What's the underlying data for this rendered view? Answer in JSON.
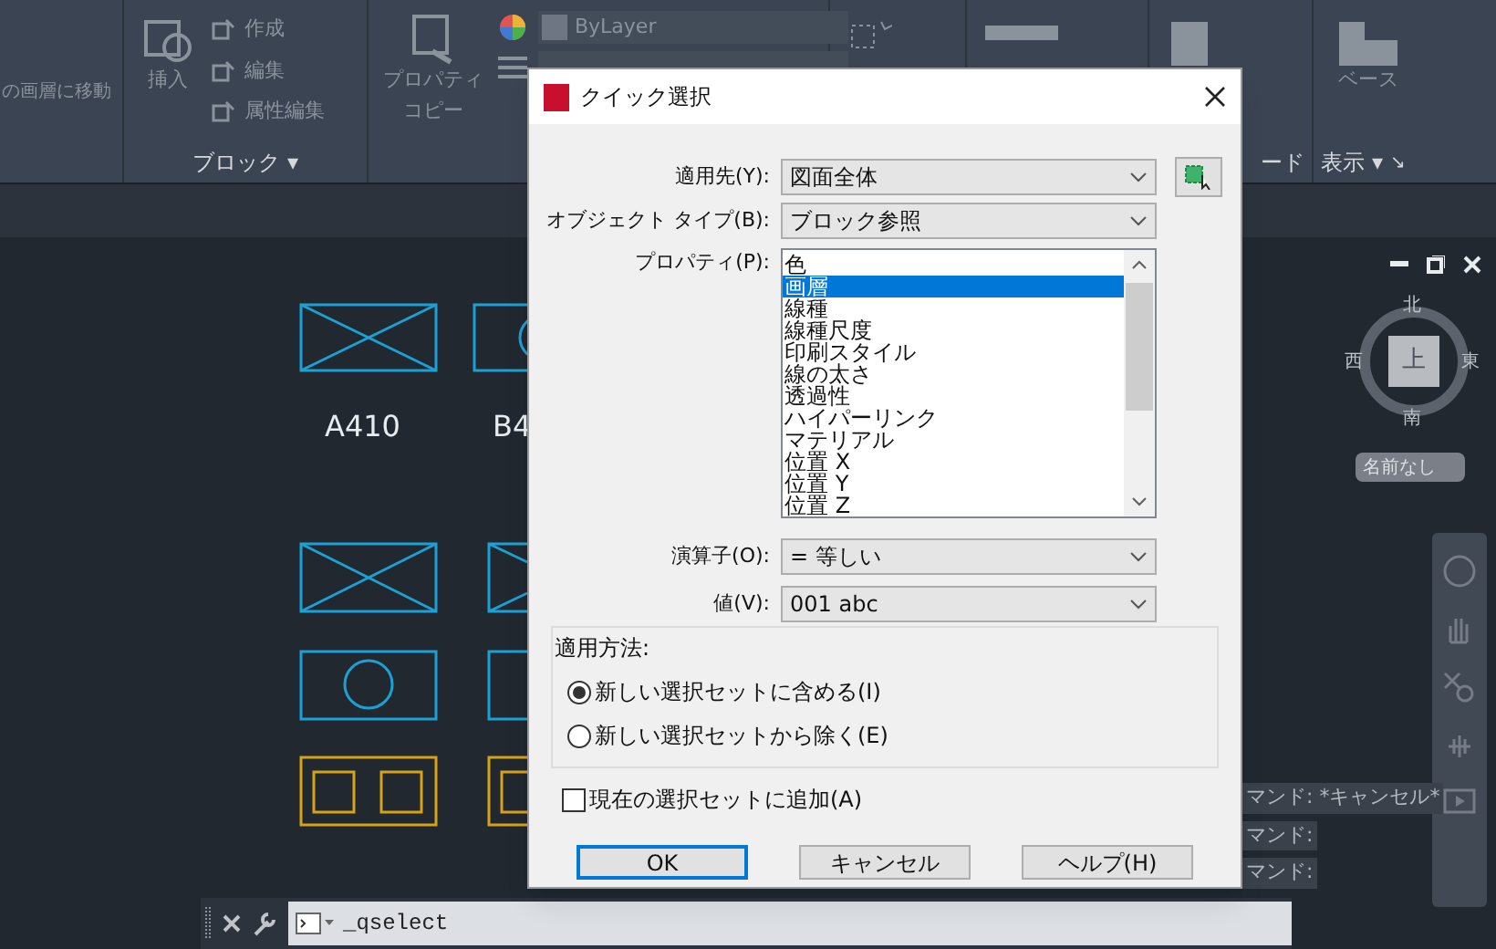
{
  "ribbon": {
    "panels": [
      {
        "kind": "layer",
        "items": [
          "の画層に移動"
        ]
      },
      {
        "kind": "block",
        "items": [
          "挿入",
          "作成",
          "編集",
          "属性編集"
        ],
        "title": "ブロック",
        "arrow": "▾"
      },
      {
        "kind": "props",
        "items": [
          "ByLayer",
          "プロパティ",
          "コピー"
        ]
      },
      {
        "kind": "icons"
      },
      {
        "kind": "icons2"
      },
      {
        "kind": "clip",
        "title": "ード"
      },
      {
        "kind": "view",
        "items": [
          "ベース"
        ],
        "title": "表示",
        "arrow": "▾",
        "launcher": "↘"
      }
    ]
  },
  "canvas": {
    "labels": [
      "A410",
      "B4"
    ]
  },
  "viewcube": {
    "top": "上",
    "north": "北",
    "south": "南",
    "east": "東",
    "west": "西",
    "ucs": "名前なし"
  },
  "command_history": [
    "マンド:  *キャンセル*",
    "マンド:",
    "マンド:"
  ],
  "command_line": {
    "value": "_qselect"
  },
  "dialog": {
    "title": "クイック選択",
    "apply_to": {
      "label": "適用先(Y):",
      "value": "図面全体"
    },
    "object_type": {
      "label": "オブジェクト タイプ(B):",
      "value": "ブロック参照"
    },
    "properties": {
      "label": "プロパティ(P):",
      "items": [
        {
          "text": "色",
          "selected": false
        },
        {
          "text": "画層",
          "selected": true
        },
        {
          "text": "線種",
          "selected": false
        },
        {
          "text": "線種尺度",
          "selected": false
        },
        {
          "text": "印刷スタイル",
          "selected": false
        },
        {
          "text": "線の太さ",
          "selected": false
        },
        {
          "text": "透過性",
          "selected": false
        },
        {
          "text": "ハイパーリンク",
          "selected": false
        },
        {
          "text": "マテリアル",
          "selected": false
        },
        {
          "text": "位置 X",
          "selected": false
        },
        {
          "text": "位置 Y",
          "selected": false
        },
        {
          "text": "位置 Z",
          "selected": false
        }
      ]
    },
    "operator": {
      "label": "演算子(O):",
      "value": "= 等しい"
    },
    "value": {
      "label": "値(V):",
      "value": "001 abc"
    },
    "how_to_apply": {
      "label": "適用方法:",
      "options": [
        {
          "text": "新しい選択セットに含める(I)",
          "selected": true
        },
        {
          "text": "新しい選択セットから除く(E)",
          "selected": false
        }
      ]
    },
    "append": {
      "text": "現在の選択セットに追加(A)",
      "checked": false
    },
    "buttons": [
      {
        "text": "OK",
        "default": true
      },
      {
        "text": "キャンセル",
        "default": false
      },
      {
        "text": "ヘルプ(H)",
        "default": false
      }
    ]
  }
}
